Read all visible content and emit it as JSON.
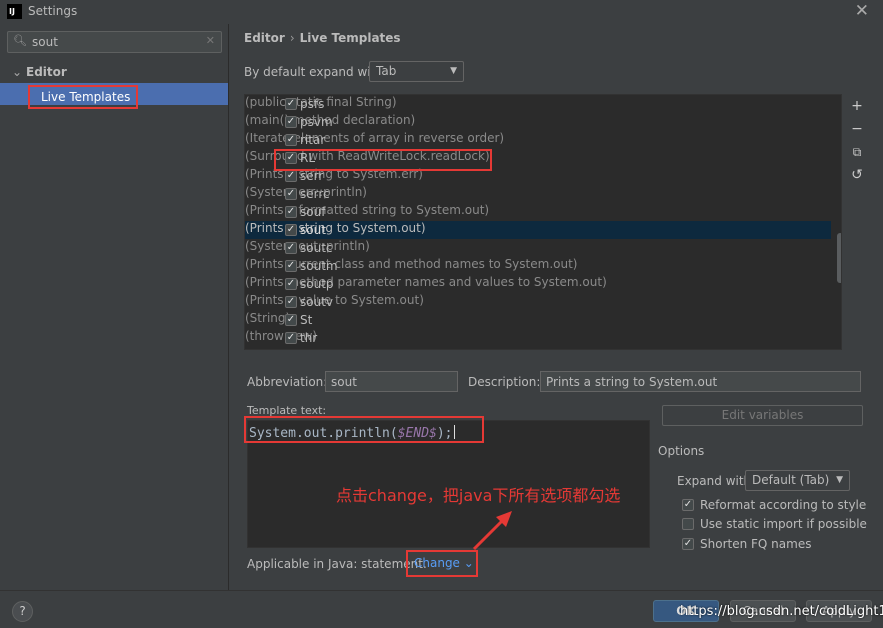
{
  "window": {
    "title": "Settings",
    "logo_text": "IJ"
  },
  "sidebar": {
    "search_value": "sout",
    "tree": {
      "group": "Editor",
      "selected": "Live Templates"
    }
  },
  "breadcrumb": {
    "first": "Editor",
    "second": "Live Templates"
  },
  "expand": {
    "label": "By default expand with",
    "value": "Tab"
  },
  "templates": [
    {
      "abbr": "psfs",
      "desc": "(public static final String)",
      "checked": true
    },
    {
      "abbr": "psvm",
      "desc": "(main() method declaration)",
      "checked": true
    },
    {
      "abbr": "ritar",
      "desc": "(Iterate elements of array in reverse order)",
      "checked": true
    },
    {
      "abbr": "RL",
      "desc": "(Surround with ReadWriteLock.readLock)",
      "checked": true
    },
    {
      "abbr": "serr",
      "desc": "(Prints a string to System.err)",
      "checked": true
    },
    {
      "abbr": "serrc",
      "desc": "(System.err::println)",
      "checked": true
    },
    {
      "abbr": "souf",
      "desc": "(Prints a formatted string to System.out)",
      "checked": true
    },
    {
      "abbr": "sout",
      "desc": "(Prints a string to System.out)",
      "checked": true,
      "selected": true
    },
    {
      "abbr": "soutc",
      "desc": "(System.out::println)",
      "checked": true
    },
    {
      "abbr": "soutm",
      "desc": "(Prints current class and method names to System.out)",
      "checked": true
    },
    {
      "abbr": "soutp",
      "desc": "(Prints method parameter names and values to System.out)",
      "checked": true
    },
    {
      "abbr": "soutv",
      "desc": "(Prints a value to System.out)",
      "checked": true
    },
    {
      "abbr": "St",
      "desc": "(String)",
      "checked": true
    },
    {
      "abbr": "thr",
      "desc": "(throw new)",
      "checked": true
    }
  ],
  "toolbar": {
    "add": "+",
    "remove": "−",
    "copy": "⧉",
    "restore": "↺"
  },
  "fields": {
    "abbreviation_label": "Abbreviation:",
    "abbreviation_value": "sout",
    "description_label": "Description:",
    "description_value": "Prints a string to System.out"
  },
  "template_text": {
    "label": "Template text:",
    "code_prefix": "System.out.println(",
    "code_var": "$END$",
    "code_suffix": ");"
  },
  "annotation": "点击change，把java下所有选项都勾选",
  "edit_variables": "Edit variables",
  "options": {
    "label": "Options",
    "expand_label": "Expand with",
    "expand_value": "Default (Tab)",
    "reformat": {
      "label": "Reformat according to style",
      "checked": true
    },
    "static_import": {
      "label": "Use static import if possible",
      "checked": false
    },
    "shorten_fq": {
      "label": "Shorten FQ names",
      "checked": true
    }
  },
  "applicable": {
    "label": "Applicable in Java: statement.",
    "change_label": "Change"
  },
  "buttons": {
    "help": "?",
    "ok": "OK",
    "cancel": "Cancel",
    "apply": "Apply"
  },
  "watermark": "https://blog.csdn.net/coldLight1",
  "colors": {
    "accent_red": "#e53935",
    "selection": "#4b6eaf",
    "link": "#589df6"
  }
}
